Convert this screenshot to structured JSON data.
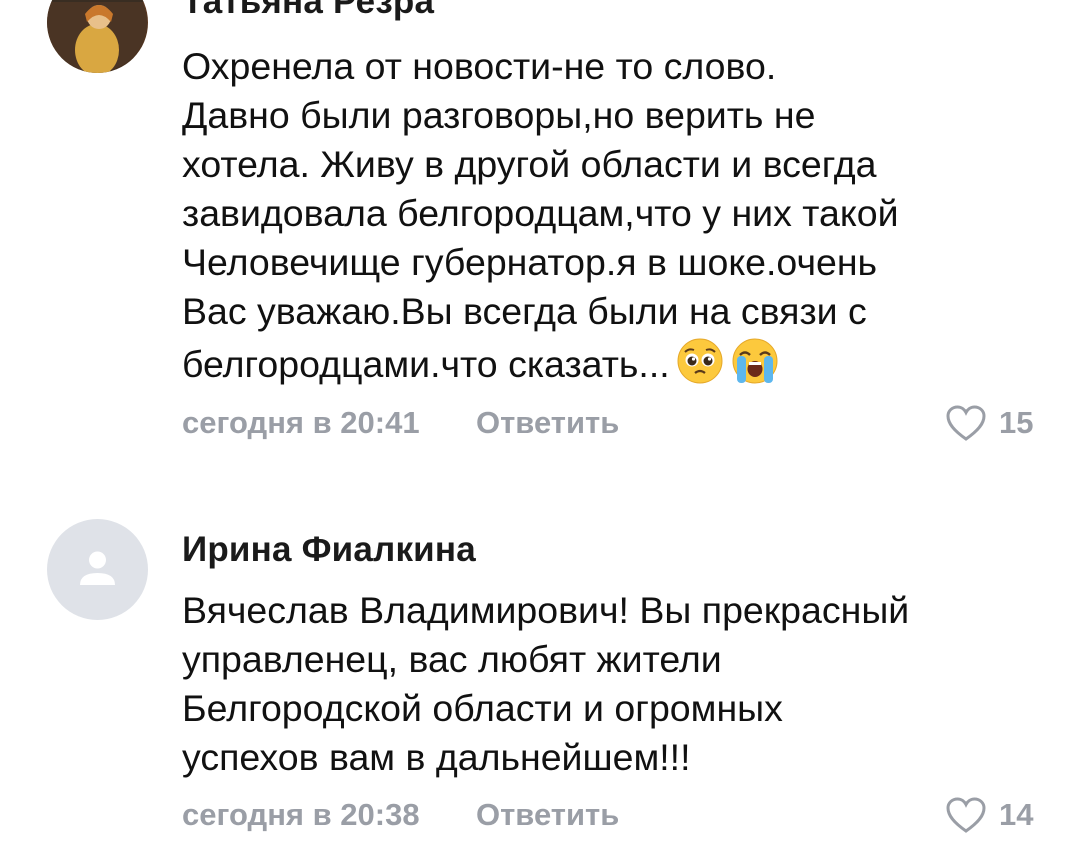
{
  "comments": [
    {
      "author": "Татьяна Резра",
      "lines": [
        "Охренела от новости-не то слово.",
        "Давно были разговоры,но верить не",
        "хотела. Живу в другой области и всегда",
        "завидовала белгородцам,что у них такой",
        "Человечище губернатор.я в шоке.очень",
        "Вас уважаю.Вы всегда были на связи с",
        "белгородцами.что сказать..."
      ],
      "emojis": [
        "pleading-face",
        "loudly-crying-face"
      ],
      "time": "сегодня в 20:41",
      "reply_label": "Ответить",
      "likes": "15"
    },
    {
      "author": "Ирина Фиалкина",
      "lines": [
        "Вячеслав Владимирович! Вы прекрасный",
        "управленец, вас любят жители",
        "Белгородской области и огромных",
        "успехов вам в дальнейшем!!!"
      ],
      "time": "сегодня в 20:38",
      "reply_label": "Ответить",
      "likes": "14"
    }
  ],
  "icons": {
    "like": "heart-outline-icon",
    "avatar_placeholder": "user-silhouette-icon"
  },
  "colors": {
    "meta_gray": "#9a9ea6",
    "text": "#111111",
    "avatar_placeholder_bg": "#dfe2e8"
  }
}
